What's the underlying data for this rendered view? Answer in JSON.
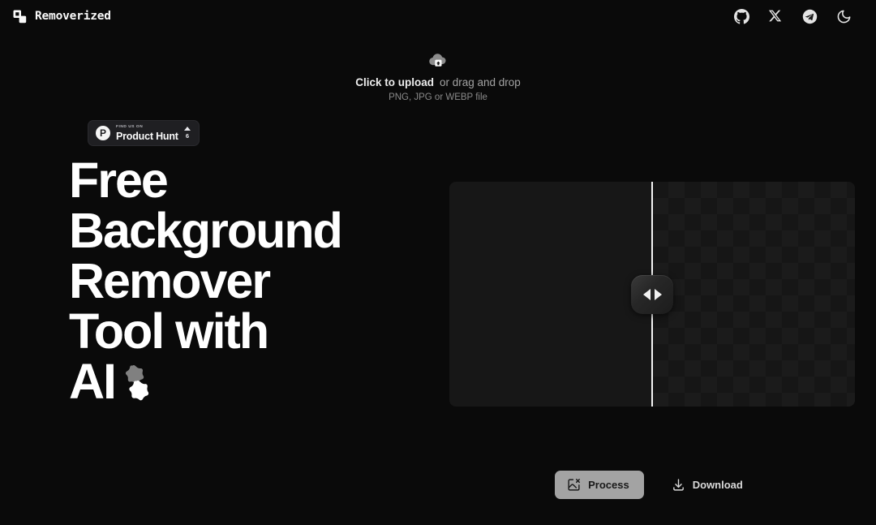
{
  "theme": {
    "background": "#0a0a0a",
    "panel": "#171717",
    "panel_checker": "#1b1b1b",
    "text_primary": "#ffffff",
    "text_muted": "#a3a3a3",
    "accent_button": "#a3a3a3",
    "divider": "#f5f5f5"
  },
  "header": {
    "brand_name": "Removerized",
    "logo_icon": "overlapping-squares-icon",
    "icons": [
      {
        "name": "github-icon",
        "label": "GitHub"
      },
      {
        "name": "x-twitter-icon",
        "label": "X"
      },
      {
        "name": "telegram-icon",
        "label": "Telegram"
      },
      {
        "name": "moon-icon",
        "label": "Toggle dark mode"
      }
    ]
  },
  "upload": {
    "icon": "cloud-upload-icon",
    "cta_strong": "Click to upload",
    "cta_normal": "or drag and drop",
    "hint": "PNG, JPG or WEBP file"
  },
  "product_hunt": {
    "logo_letter": "P",
    "kicker": "FIND US ON",
    "title": "Product Hunt",
    "upvote_count": "6"
  },
  "hero": {
    "line1": "Free",
    "line2": "Background",
    "line3": "Remover",
    "line4": "Tool with",
    "line5": "AI",
    "decoration_icon": "sparkle-stars-icon"
  },
  "compare": {
    "divider_position_percent": 50,
    "handle_icon": "left-right-arrows-icon",
    "before_label": "",
    "after_label": ""
  },
  "actions": {
    "process_label": "Process",
    "process_icon": "image-remove-icon",
    "download_label": "Download",
    "download_icon": "download-icon"
  }
}
